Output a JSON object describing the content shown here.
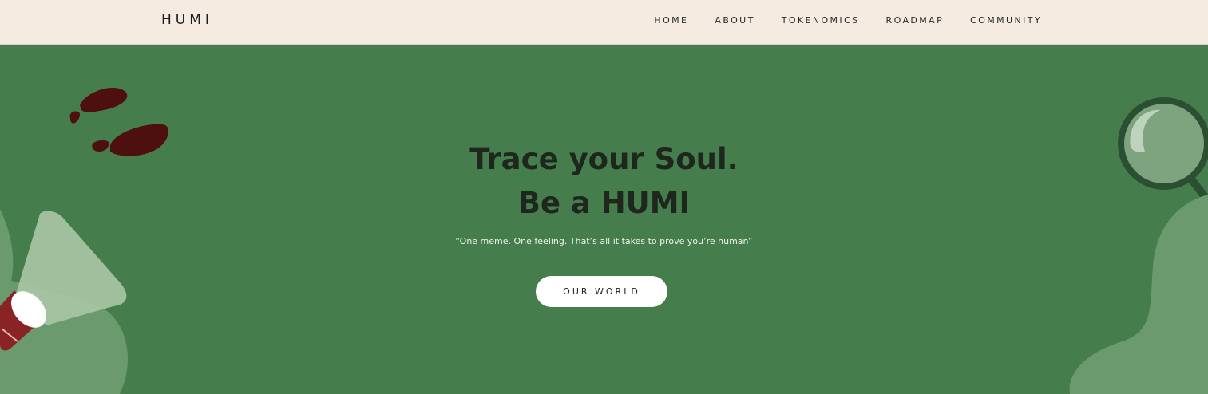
{
  "nav": {
    "logo": "HUMI",
    "links": [
      "HOME",
      "ABOUT",
      "TOKENOMICS",
      "ROADMAP",
      "COMMUNITY"
    ]
  },
  "hero": {
    "headline_line1": "Trace your Soul.",
    "headline_line2": "Be a HUMI",
    "tagline": "“One meme. One feeling. That’s all it takes to prove you’re human”",
    "cta_label": "OUR WORLD"
  },
  "colors": {
    "hero_background": "#457d4c",
    "nav_background": "#f5ebe0",
    "footprint": "#4e0f0f",
    "megaphone_red": "#8a2323",
    "light_blob": "#6b9a6f"
  },
  "decorations": {
    "footprints_icon": "footprints-icon",
    "megaphone_icon": "megaphone-icon",
    "magnifier_icon": "magnifying-glass-icon"
  }
}
